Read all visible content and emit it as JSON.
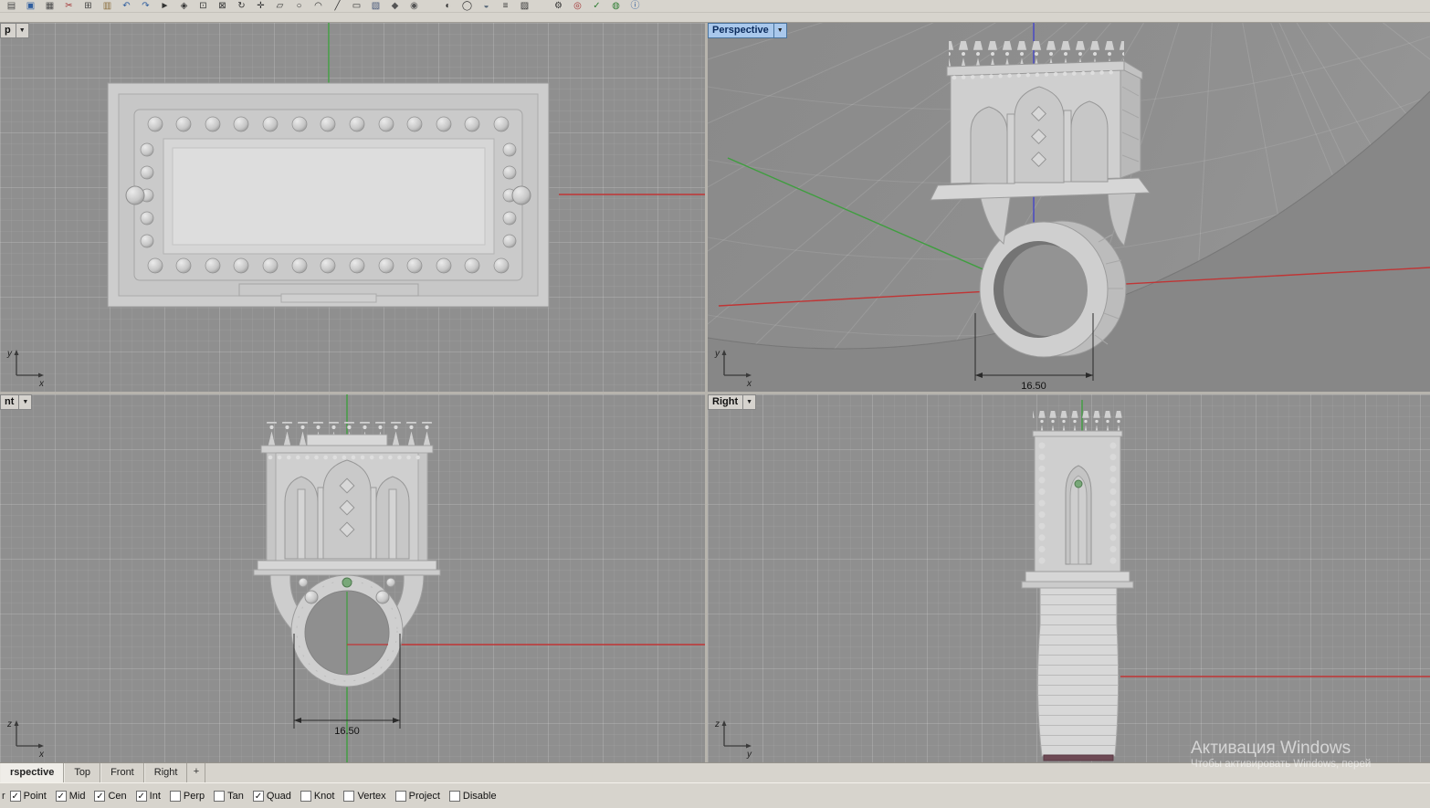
{
  "ui": {
    "caret": "▼"
  },
  "toolbar": {
    "icons": [
      {
        "name": "new-file-icon",
        "glyph": "▤",
        "color": "#4a4a4a"
      },
      {
        "name": "save-icon",
        "glyph": "▣",
        "color": "#2f5e9e"
      },
      {
        "name": "print-icon",
        "glyph": "▦",
        "color": "#4a4a4a"
      },
      {
        "name": "cut-icon",
        "glyph": "✂",
        "color": "#a33333"
      },
      {
        "name": "copy-icon",
        "glyph": "⊞",
        "color": "#444444"
      },
      {
        "name": "paste-icon",
        "glyph": "▥",
        "color": "#8a6d3b"
      },
      {
        "name": "undo-icon",
        "glyph": "↶",
        "color": "#2f5e9e"
      },
      {
        "name": "redo-icon",
        "glyph": "↷",
        "color": "#2f5e9e"
      },
      {
        "name": "select-arrow-icon",
        "glyph": "►",
        "color": "#333333"
      },
      {
        "name": "pan-icon",
        "glyph": "◈",
        "color": "#333333"
      },
      {
        "name": "zoom-window-icon",
        "glyph": "⊡",
        "color": "#333333"
      },
      {
        "name": "zoom-extents-icon",
        "glyph": "⊠",
        "color": "#333333"
      },
      {
        "name": "rotate-view-icon",
        "glyph": "↻",
        "color": "#333333"
      },
      {
        "name": "move-icon",
        "glyph": "✛",
        "color": "#333333"
      },
      {
        "name": "plane-icon",
        "glyph": "▱",
        "color": "#333333"
      },
      {
        "name": "circle-icon",
        "glyph": "○",
        "color": "#333333"
      },
      {
        "name": "arc-icon",
        "glyph": "◠",
        "color": "#333333"
      },
      {
        "name": "line-icon",
        "glyph": "╱",
        "color": "#333333"
      },
      {
        "name": "rectangle-icon",
        "glyph": "▭",
        "color": "#333333"
      },
      {
        "name": "surface-icon",
        "glyph": "▧",
        "color": "#445577"
      },
      {
        "name": "polysurface-icon",
        "glyph": "◆",
        "color": "#555555"
      },
      {
        "name": "sphere-icon",
        "glyph": "◉",
        "color": "#555555"
      },
      {
        "name": "shaded-view-icon",
        "glyph": "◐",
        "color": "#333333",
        "gap": true
      },
      {
        "name": "wireframe-view-icon",
        "glyph": "◯",
        "color": "#333333"
      },
      {
        "name": "ghosted-view-icon",
        "glyph": "◒",
        "color": "#556677"
      },
      {
        "name": "layers-icon",
        "glyph": "≡",
        "color": "#333333"
      },
      {
        "name": "hatch-icon",
        "glyph": "▨",
        "color": "#333333"
      },
      {
        "name": "settings-gear-icon",
        "glyph": "⚙",
        "color": "#333333",
        "gap": true
      },
      {
        "name": "target-icon",
        "glyph": "◎",
        "color": "#a33333"
      },
      {
        "name": "check-icon",
        "glyph": "✓",
        "color": "#2e7d32"
      },
      {
        "name": "globe-icon",
        "glyph": "◍",
        "color": "#2e7d32"
      },
      {
        "name": "info-icon",
        "glyph": "ⓘ",
        "color": "#2f5e9e"
      }
    ]
  },
  "viewports": {
    "top": {
      "title": "p",
      "axis_v": "y",
      "axis_h": "x"
    },
    "perspective": {
      "title": "Perspective",
      "axis_v": "y",
      "axis_h": "x",
      "dimension": "16.50"
    },
    "front": {
      "title": "nt",
      "axis_v": "z",
      "axis_h": "x",
      "dimension": "16.50"
    },
    "right": {
      "title": "Right",
      "axis_v": "z",
      "axis_h": "y"
    }
  },
  "viewport_tabs": {
    "tabs": [
      {
        "label": "rspective",
        "name": "tab-perspective",
        "active": true
      },
      {
        "label": "Top",
        "name": "tab-top"
      },
      {
        "label": "Front",
        "name": "tab-front"
      },
      {
        "label": "Right",
        "name": "tab-right"
      }
    ],
    "new_label": "+"
  },
  "osnap": {
    "leading": "r",
    "items": [
      {
        "label": "Point",
        "name": "osnap-point",
        "checked": true
      },
      {
        "label": "Mid",
        "name": "osnap-mid",
        "checked": true
      },
      {
        "label": "Cen",
        "name": "osnap-cen",
        "checked": true
      },
      {
        "label": "Int",
        "name": "osnap-int",
        "checked": true
      },
      {
        "label": "Perp",
        "name": "osnap-perp",
        "checked": false
      },
      {
        "label": "Tan",
        "name": "osnap-tan",
        "checked": false
      },
      {
        "label": "Quad",
        "name": "osnap-quad",
        "checked": true
      },
      {
        "label": "Knot",
        "name": "osnap-knot",
        "checked": false
      },
      {
        "label": "Vertex",
        "name": "osnap-vertex",
        "checked": false
      },
      {
        "label": "Project",
        "name": "osnap-project",
        "checked": false
      },
      {
        "label": "Disable",
        "name": "osnap-disable",
        "checked": false
      }
    ]
  },
  "watermark": {
    "title": "Активация Windows",
    "subtitle": "Чтобы активировать Windows, перей"
  },
  "colors": {
    "axis_x": "#c03535",
    "axis_y": "#3f9e3f",
    "axis_z": "#4444c8",
    "active_title_bg": "#a9c8ec"
  }
}
